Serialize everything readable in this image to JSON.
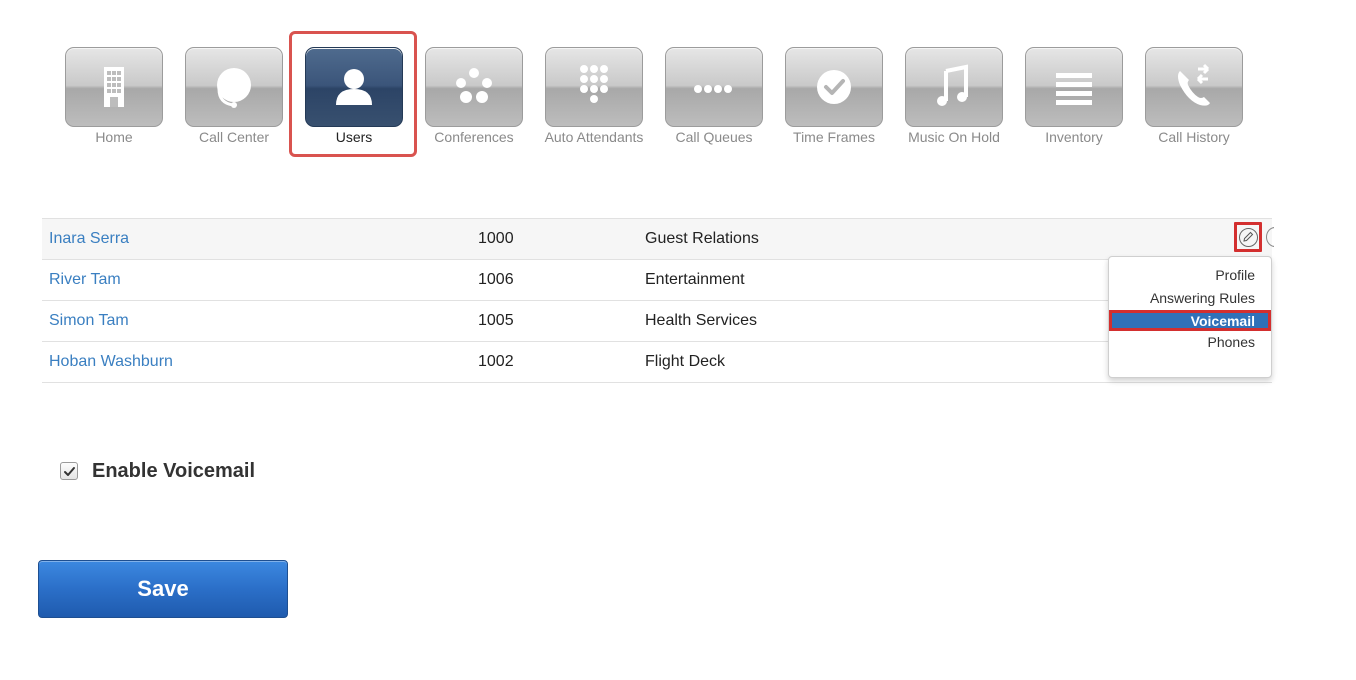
{
  "nav": {
    "items": [
      {
        "label": "Home",
        "icon": "building-icon"
      },
      {
        "label": "Call Center",
        "icon": "headset-icon"
      },
      {
        "label": "Users",
        "icon": "user-icon"
      },
      {
        "label": "Conferences",
        "icon": "conference-dots-icon"
      },
      {
        "label": "Auto Attendants",
        "icon": "keypad-icon"
      },
      {
        "label": "Call Queues",
        "icon": "queue-dots-icon"
      },
      {
        "label": "Time Frames",
        "icon": "clock-check-icon"
      },
      {
        "label": "Music On Hold",
        "icon": "music-note-icon"
      },
      {
        "label": "Inventory",
        "icon": "list-lines-icon"
      },
      {
        "label": "Call History",
        "icon": "phone-history-icon"
      }
    ],
    "active": "Users"
  },
  "users": {
    "rows": [
      {
        "name": "Inara Serra",
        "extension": "1000",
        "department": "Guest Relations"
      },
      {
        "name": "River Tam",
        "extension": "1006",
        "department": "Entertainment"
      },
      {
        "name": "Simon Tam",
        "extension": "1005",
        "department": "Health Services"
      },
      {
        "name": "Hoban Washburn",
        "extension": "1002",
        "department": "Flight Deck"
      }
    ]
  },
  "dropdown": {
    "items": [
      "Profile",
      "Answering Rules",
      "Voicemail",
      "Phones"
    ],
    "selected": "Voicemail"
  },
  "voicemail": {
    "label": "Enable Voicemail",
    "checked": true
  },
  "save": {
    "label": "Save"
  },
  "colors": {
    "link": "#3a7fc1",
    "highlight_red": "#d32f2f",
    "accent_blue": "#3071b8"
  }
}
